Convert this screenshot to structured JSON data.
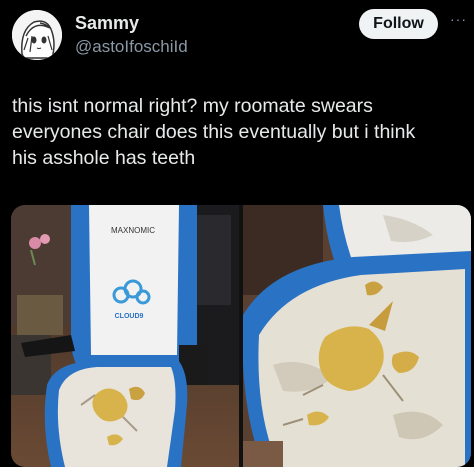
{
  "author": {
    "display_name": "Sammy",
    "handle": "@astoIfoschiId",
    "avatar_icon": "anime-character-avatar"
  },
  "follow_label": "Follow",
  "more_glyph": "···",
  "tweet_text": "this isnt normal right? my roomate swears\neveryones chair does this eventually but i think\nhis asshole has teeth",
  "media": {
    "left_chair_brand": "MAXNOMIC",
    "left_chair_logo_text": "CLOUD9",
    "colors": {
      "chair_blue": "#2a72c4",
      "chair_white": "#f2f2f2",
      "foam_yellow": "#d8b24a",
      "floor_brown": "#5a4030"
    }
  }
}
